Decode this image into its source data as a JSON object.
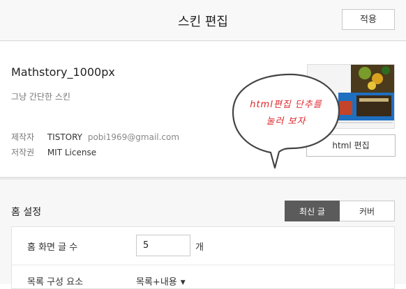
{
  "header": {
    "title": "스킨 편집",
    "apply_label": "적용"
  },
  "skin": {
    "name": "Mathstory_1000px",
    "description": "그냥 간단한 스킨",
    "author_label": "제작자",
    "author": "TISTORY",
    "author_email": "pobi1969@gmail.com",
    "license_label": "저작권",
    "license": "MIT License",
    "html_edit_label": "html 편집"
  },
  "annotation": {
    "line1": "html편집 단추를",
    "line2": "눌러 보자"
  },
  "home": {
    "title": "홈 설정",
    "tabs": [
      {
        "label": "최신 글",
        "active": true
      },
      {
        "label": "커버",
        "active": false
      }
    ],
    "post_count_label": "홈 화면 글 수",
    "post_count_value": "5",
    "post_count_unit": "개",
    "list_component_label": "목록 구성 요소",
    "list_component_value": "목록+내용"
  },
  "colors": {
    "accent_red": "#e0262b",
    "segment_active": "#5b5b5b"
  }
}
